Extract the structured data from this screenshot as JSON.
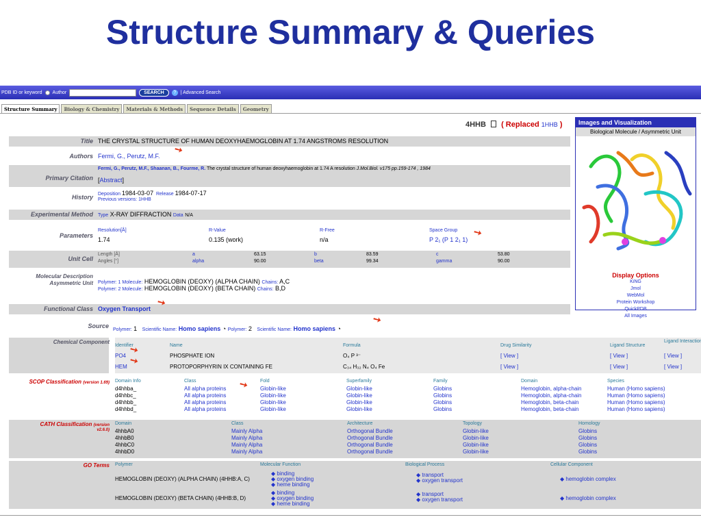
{
  "slide": {
    "title": "Structure Summary & Queries"
  },
  "topbar": {
    "prefix": "PDB ID or keyword",
    "author": "Author",
    "search": "SEARCH",
    "advanced": "| Advanced Search"
  },
  "tabs": [
    "Structure Summary",
    "Biology & Chemistry",
    "Materials & Methods",
    "Sequence Details",
    "Geometry"
  ],
  "entry": {
    "id": "4HHB",
    "replaced_open": "( Replaced",
    "replaced_id": "1HHB",
    "replaced_close": ")"
  },
  "rows": {
    "title": {
      "label": "Title",
      "value": "THE CRYSTAL STRUCTURE OF HUMAN DEOXYHAEMOGLOBIN AT 1.74 ANGSTROMS RESOLUTION"
    },
    "authors": {
      "label": "Authors",
      "value": "Fermi, G.,  Perutz, M.F."
    },
    "citation": {
      "label": "Primary Citation",
      "authors": "Fermi, G.,  Perutz, M.F.,  Shaanan, B.,  Fourme, R.",
      "text": "The crystal structure of human deoxyhaemoglobin at 1.74 A resolution",
      "journal": "J.Mol.Biol.  v175  pp.159-174 , 1984",
      "abstract": "Abstract"
    },
    "history": {
      "label": "History",
      "deposition_l": "Deposition",
      "deposition": "1984-03-07",
      "release_l": "Release",
      "release": "1984-07-17",
      "prev_l": "Previous versions:",
      "prev": "1HHB"
    },
    "method": {
      "label": "Experimental Method",
      "type_l": "Type",
      "type": "X-RAY DIFFRACTION",
      "data_l": "Data",
      "data": "N/A"
    },
    "params": {
      "label": "Parameters",
      "res_l": "Resolution[Å]",
      "res": "1.74",
      "rv_l": "R-Value",
      "rv": "0.135 (work)",
      "rf_l": "R-Free",
      "rf": "n/a",
      "sg_l": "Space Group",
      "sg": "P 2₁ (P 1 2₁ 1)"
    },
    "cell": {
      "label": "Unit Cell",
      "len_l": "Length [Å]",
      "ang_l": "Angles [°]",
      "a_l": "a",
      "a": "63.15",
      "alpha_l": "alpha",
      "alpha": "90.00",
      "b_l": "b",
      "b": "83.59",
      "beta_l": "beta",
      "beta": "99.34",
      "c_l": "c",
      "c": "53.80",
      "gamma_l": "gamma",
      "gamma": "90.00"
    },
    "moldesc": {
      "label1": "Molecular Description",
      "label2": "Asymmetric Unit",
      "p1": "Polymer: 1  Molecule:",
      "m1": "HEMOGLOBIN (DEOXY) (ALPHA CHAIN)",
      "c1l": "Chains:",
      "c1": "A,C",
      "p2": "Polymer: 2  Molecule:",
      "m2": "HEMOGLOBIN (DEOXY) (BETA CHAIN)",
      "c2l": "Chains:",
      "c2": "B,D"
    },
    "fclass": {
      "label": "Functional Class",
      "value": "Oxygen Transport"
    },
    "source": {
      "label": "Source",
      "p1l": "Polymer:",
      "p1": "1",
      "sn1l": "Scientific Name:",
      "sn1": "Homo sapiens",
      "p2l": "Polymer:",
      "p2": "2",
      "sn2l": "Scientific Name:",
      "sn2": "Homo sapiens"
    }
  },
  "side": {
    "header": "Images and Visualization",
    "sub": "Biological Molecule / Asymmetric Unit",
    "opts_title": "Display Options",
    "opts": [
      "KiNG",
      "Jmol",
      "WebMol",
      "Protein Workshop",
      "QuickPDB",
      "All Images"
    ]
  },
  "chem": {
    "label": "Chemical Component",
    "headers": [
      "Identifier",
      "Name",
      "Formula",
      "Drug Similarity",
      "Ligand Structure",
      "Ligand Interaction"
    ],
    "rows": [
      [
        "PO4",
        "PHOSPHATE ION",
        "O₄ P ³⁻",
        "[ View ]",
        "[ View ]",
        "[ View ]"
      ],
      [
        "HEM",
        "PROTOPORPHYRIN IX CONTAINING FE",
        "C₃₄ H₃₂ N₄ O₄ Fe",
        "[ View ]",
        "[ View ]",
        "[ View ]"
      ]
    ]
  },
  "scop": {
    "label": "SCOP Classification",
    "version": "(version 1.69)",
    "headers": [
      "Domain Info",
      "Class",
      "Fold",
      "Superfamily",
      "Family",
      "Domain",
      "Species"
    ],
    "rows": [
      [
        "d4hhba_",
        "All alpha proteins",
        "Globin-like",
        "Globin-like",
        "Globins",
        "Hemoglobin, alpha-chain",
        "Human (Homo sapiens)"
      ],
      [
        "d4hhbc_",
        "All alpha proteins",
        "Globin-like",
        "Globin-like",
        "Globins",
        "Hemoglobin, alpha-chain",
        "Human (Homo sapiens)"
      ],
      [
        "d4hhbb_",
        "All alpha proteins",
        "Globin-like",
        "Globin-like",
        "Globins",
        "Hemoglobin, beta-chain",
        "Human (Homo sapiens)"
      ],
      [
        "d4hhbd_",
        "All alpha proteins",
        "Globin-like",
        "Globin-like",
        "Globins",
        "Hemoglobin, beta-chain",
        "Human (Homo sapiens)"
      ]
    ]
  },
  "cath": {
    "label": "CATH Classification",
    "version1": "(version",
    "version2": "v2.6.0)",
    "headers": [
      "Domain",
      "Class",
      "Architecture",
      "Topology",
      "Homology"
    ],
    "rows": [
      [
        "4hhbA0",
        "Mainly Alpha",
        "Orthogonal Bundle",
        "Globin-like",
        "Globins"
      ],
      [
        "4hhbB0",
        "Mainly Alpha",
        "Orthogonal Bundle",
        "Globin-like",
        "Globins"
      ],
      [
        "4hhbC0",
        "Mainly Alpha",
        "Orthogonal Bundle",
        "Globin-like",
        "Globins"
      ],
      [
        "4hhbD0",
        "Mainly Alpha",
        "Orthogonal Bundle",
        "Globin-like",
        "Globins"
      ]
    ]
  },
  "go": {
    "label": "GO Terms",
    "headers": [
      "Polymer",
      "Molecular Function",
      "Biological Process",
      "Cellular Component"
    ],
    "rows": [
      {
        "polymer": "HEMOGLOBIN (DEOXY) (ALPHA CHAIN) (4HHB:A, C)",
        "mf": [
          "binding",
          "oxygen binding",
          "heme binding"
        ],
        "bp": [
          "transport",
          "oxygen transport"
        ],
        "cc": [
          "hemoglobin complex"
        ]
      },
      {
        "polymer": "HEMOGLOBIN (DEOXY) (BETA CHAIN) (4HHB:B, D)",
        "mf": [
          "binding",
          "oxygen binding",
          "heme binding"
        ],
        "bp": [
          "transport",
          "oxygen transport"
        ],
        "cc": [
          "hemoglobin complex"
        ]
      }
    ]
  },
  "colors": {
    "title": "#1f2f9e",
    "bar": "#2a2fb5",
    "link": "#2233cc",
    "red": "#c00000",
    "arrow": "#e23a1a"
  }
}
